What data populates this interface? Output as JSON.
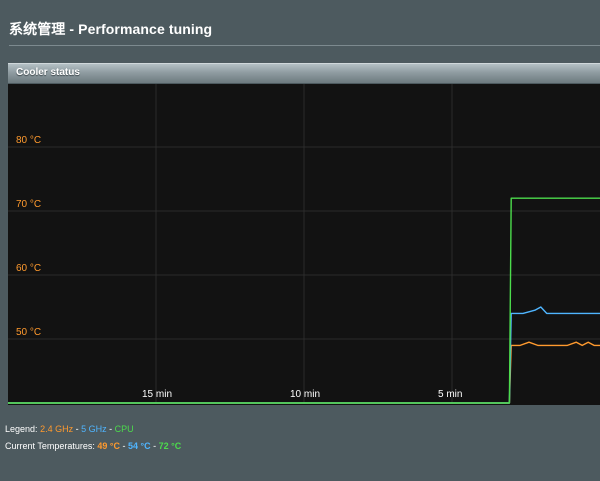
{
  "page": {
    "title": "系统管理 - Performance tuning"
  },
  "panel": {
    "header": "Cooler status"
  },
  "legend": {
    "prefix": "Legend:",
    "items": [
      "2.4 GHz",
      "5 GHz",
      "CPU"
    ],
    "separator": " - "
  },
  "temperatures": {
    "prefix": "Current Temperatures:",
    "values": [
      "49 °C",
      "54 °C",
      "72 °C"
    ]
  },
  "colors": {
    "band_2_4ghz": "#ff9a2e",
    "band_5ghz": "#4fb5ff",
    "cpu": "#4cdc4c",
    "chart_bg": "#121212",
    "grid": "#2b2b2b",
    "y_tick_label": "#ff9a2e",
    "x_tick_label": "#ffffff"
  },
  "chart_data": {
    "type": "line",
    "title": "Cooler status",
    "xlabel": "",
    "ylabel": "",
    "x_unit": "minutes ago",
    "x_range": [
      20,
      0
    ],
    "y_range": [
      40,
      90
    ],
    "y_ticks": [
      {
        "value": 50,
        "label": "50 °C"
      },
      {
        "value": 60,
        "label": "60 °C"
      },
      {
        "value": 70,
        "label": "70 °C"
      },
      {
        "value": 80,
        "label": "80 °C"
      }
    ],
    "x_ticks": [
      {
        "value": 15,
        "label": "15 min"
      },
      {
        "value": 10,
        "label": "10 min"
      },
      {
        "value": 5,
        "label": "5 min"
      }
    ],
    "grid": true,
    "legend": "below chart, left",
    "series": [
      {
        "name": "2.4 GHz",
        "color": "#ff9a2e",
        "x": [
          20,
          3.06,
          3.0,
          2.7,
          2.4,
          2.1,
          1.8,
          1.6,
          1.4,
          1.1,
          0.8,
          0.6,
          0.4,
          0.2,
          0.0
        ],
        "y": [
          40,
          40,
          49,
          49,
          49.5,
          49,
          49,
          49,
          49,
          49,
          49.5,
          49,
          49.5,
          49,
          49
        ]
      },
      {
        "name": "5 GHz",
        "color": "#4fb5ff",
        "x": [
          20,
          3.06,
          3.0,
          2.6,
          2.2,
          2.0,
          1.8,
          1.5,
          1.0,
          0.5,
          0.0
        ],
        "y": [
          40,
          40,
          54,
          54,
          54.5,
          55,
          54,
          54,
          54,
          54,
          54
        ]
      },
      {
        "name": "CPU",
        "color": "#4cdc4c",
        "x": [
          20,
          3.06,
          3.0,
          2.0,
          1.0,
          0.0
        ],
        "y": [
          40,
          40,
          72,
          72,
          72,
          72
        ]
      }
    ]
  }
}
